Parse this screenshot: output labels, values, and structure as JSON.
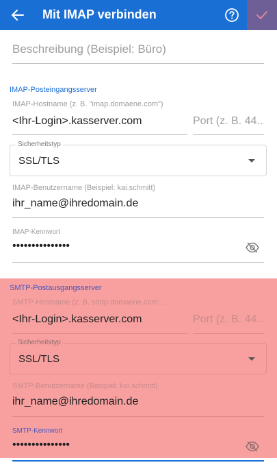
{
  "appbar": {
    "title": "Mit IMAP verbinden",
    "bg_color": "#1a6fd4",
    "confirm_bg_color": "#6e5f97"
  },
  "description": {
    "placeholder": "Beschreibung (Beispiel: Büro)"
  },
  "imap": {
    "section_title": "IMAP-Posteingangsserver",
    "host_label": "IMAP-Hostname (z. B. \"imap.domaene.com\")",
    "host_value": "<Ihr-Login>.kasserver.com",
    "port_placeholder": "Port (z. B. 44...",
    "security_label": "Sicherheitstyp",
    "security_value": "SSL/TLS",
    "user_label": "IMAP-Benutzername (Beispiel: kai.schmitt)",
    "user_value": "ihr_name@ihredomain.de",
    "password_label": "IMAP-Kennwort",
    "password_value": "•••••••••••••••"
  },
  "smtp": {
    "section_title": "SMTP-Postausgangsserver",
    "highlight_color": "#f8a0a0",
    "host_label": "SMTP-Hostname (z. B. smtp.domaene.com:...",
    "host_value": "<Ihr-Login>.kasserver.com",
    "port_placeholder": "Port (z. B. 44...",
    "security_label": "Sicherheitstyp",
    "security_value": "SSL/TLS",
    "user_label": "SMTP-Benutzername (Beispiel: kai.schmitt)",
    "user_value": "ihr_name@ihredomain.de",
    "password_label": "SMTP-Kennwort",
    "password_value": "•••••••••••••••"
  },
  "icons": {
    "back": "arrow-left-icon",
    "help": "help-circle-icon",
    "confirm": "checkmark-icon",
    "visibility": "eye-off-icon",
    "dropdown": "dropdown-arrow-icon"
  }
}
